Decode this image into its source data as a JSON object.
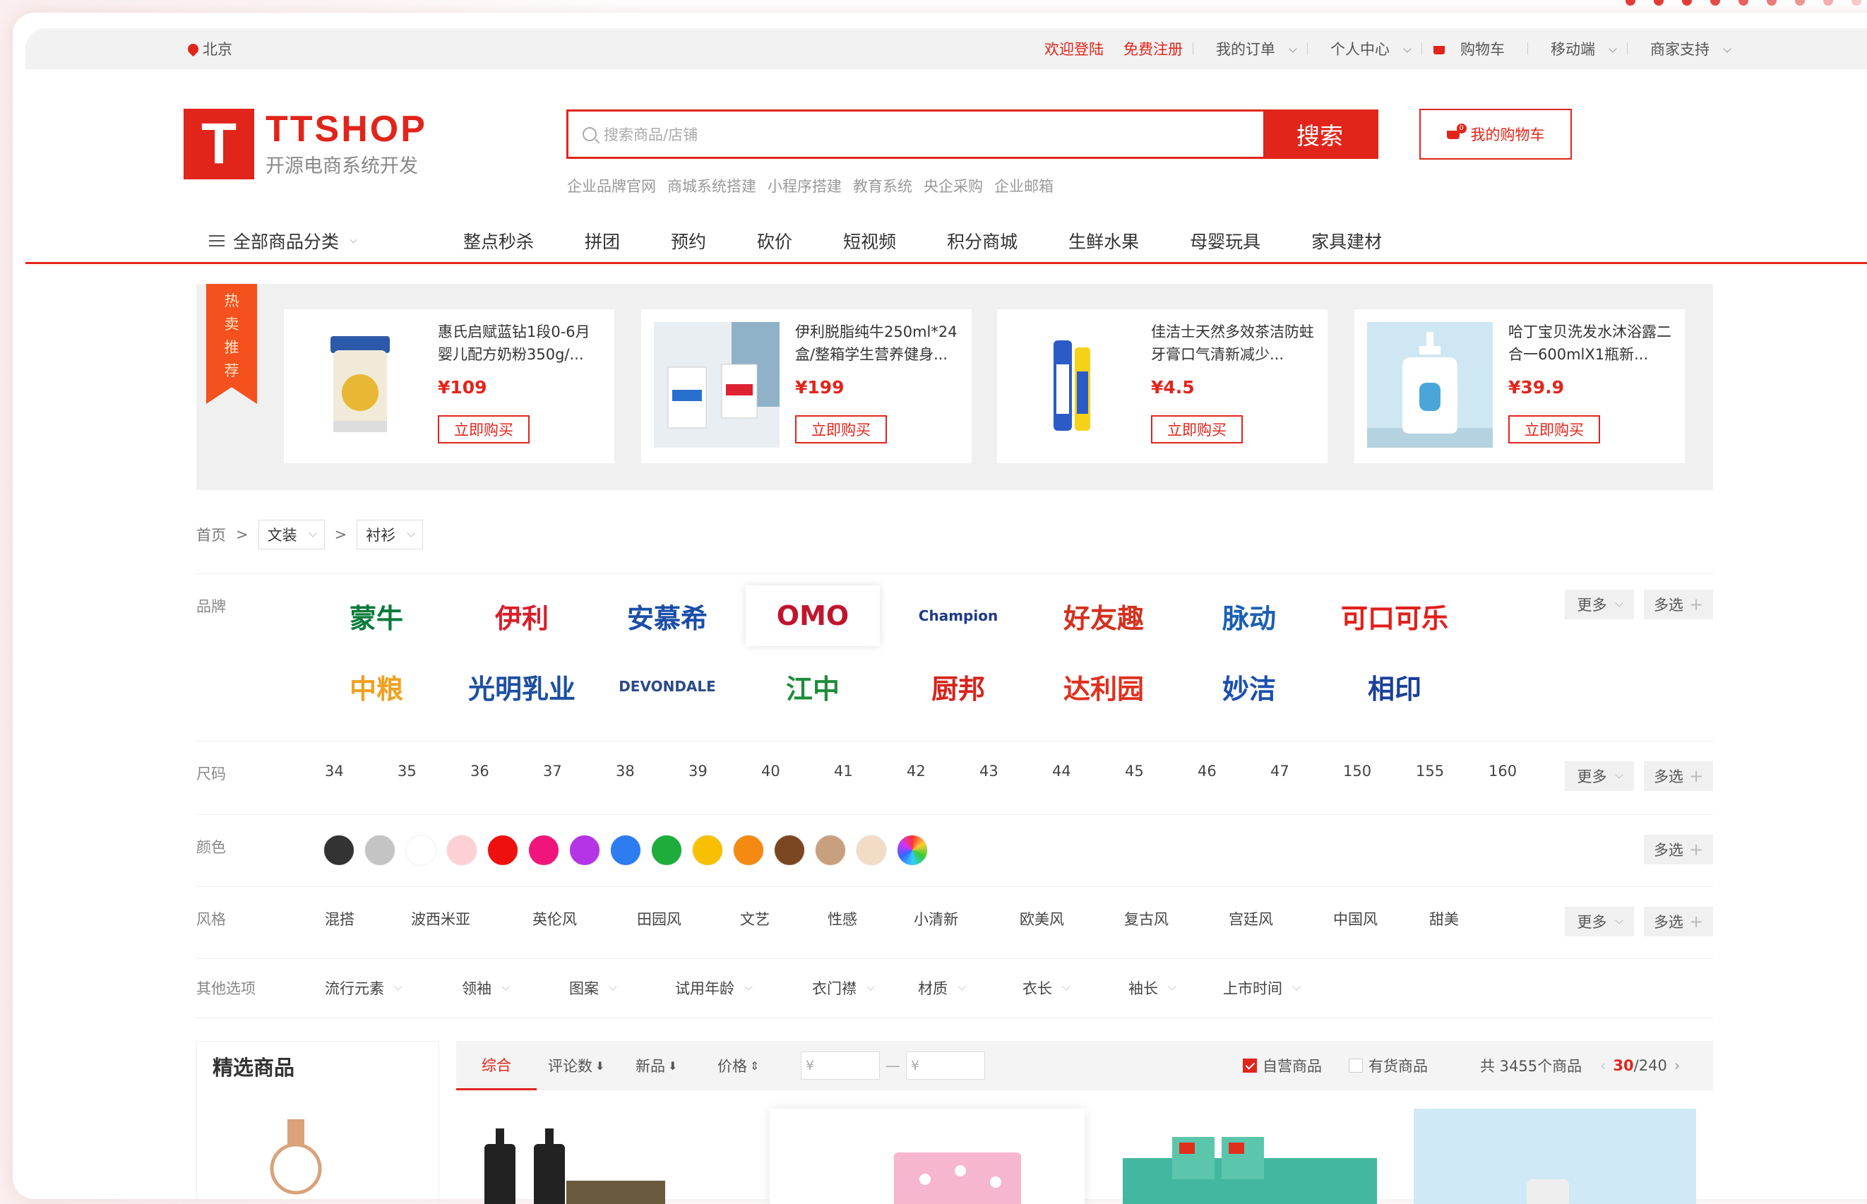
{
  "topbar": {
    "location": "北京",
    "login": "欢迎登陆",
    "register": "免费注册",
    "orders": "我的订单",
    "account": "个人中心",
    "cart": "购物车",
    "mobile": "移动端",
    "merchant": "商家支持"
  },
  "logo": {
    "mark": "T",
    "brand": "TTSHOP",
    "slogan": "开源电商系统开发"
  },
  "search": {
    "placeholder": "搜索商品/店铺",
    "button": "搜索",
    "hotwords": [
      "企业品牌官网",
      "商城系统搭建",
      "小程序搭建",
      "教育系统",
      "央企采购",
      "企业邮箱"
    ]
  },
  "mycart": {
    "label": "我的购物车",
    "count": "0"
  },
  "nav": {
    "allcat": "全部商品分类",
    "items": [
      "整点秒杀",
      "拼团",
      "预约",
      "砍价",
      "短视频",
      "积分商城",
      "生鲜水果",
      "母婴玩具",
      "家具建材"
    ]
  },
  "hot": {
    "ribbon": "热卖推荐",
    "cards": [
      {
        "name": "惠氏启赋蓝钻1段0-6月婴儿配方奶粉350g/...",
        "price": "¥109",
        "buy": "立即购买"
      },
      {
        "name": "伊利脱脂纯牛250ml*24盒/整箱学生营养健身...",
        "price": "¥199",
        "buy": "立即购买"
      },
      {
        "name": "佳洁士天然多效茶洁防蛀牙膏口气清新减少...",
        "price": "¥4.5",
        "buy": "立即购买"
      },
      {
        "name": "哈丁宝贝洗发水沐浴露二合一600mlX1瓶新...",
        "price": "¥39.9",
        "buy": "立即购买"
      }
    ]
  },
  "breadcrumb": {
    "home": "首页",
    "level1": "文装",
    "level2": "衬衫"
  },
  "filters": {
    "brand_label": "品牌",
    "brands": [
      {
        "name": "蒙牛",
        "color": "#0a7a3a"
      },
      {
        "name": "伊利",
        "color": "#d81e2a"
      },
      {
        "name": "安慕希",
        "color": "#1a4ea8"
      },
      {
        "name": "OMO",
        "color": "#c0142d"
      },
      {
        "name": "Champion",
        "color": "#1d3a8a"
      },
      {
        "name": "好友趣",
        "color": "#d4301f"
      },
      {
        "name": "脉动",
        "color": "#1a5fb4"
      },
      {
        "name": "可口可乐",
        "color": "#e0201b"
      },
      {
        "name": "中粮",
        "color": "#f0a020"
      },
      {
        "name": "光明乳业",
        "color": "#1c4fa0"
      },
      {
        "name": "DEVONDALE",
        "color": "#2a4a8a"
      },
      {
        "name": "江中",
        "color": "#1f8c3a"
      },
      {
        "name": "厨邦",
        "color": "#d4241c"
      },
      {
        "name": "达利园",
        "color": "#e0301c"
      },
      {
        "name": "妙洁",
        "color": "#1a4fb0"
      },
      {
        "name": "相印",
        "color": "#1a3f9a"
      }
    ],
    "size_label": "尺码",
    "sizes": [
      "34",
      "35",
      "36",
      "37",
      "38",
      "39",
      "40",
      "41",
      "42",
      "43",
      "44",
      "45",
      "46",
      "47",
      "150",
      "155",
      "160"
    ],
    "color_label": "颜色",
    "colors": [
      "#333333",
      "#c4c4c4",
      "#ffffff",
      "#fcd0d4",
      "#f00f0f",
      "#f0157a",
      "#b534e6",
      "#2d7cf0",
      "#1ead3a",
      "#f8c000",
      "#f48a12",
      "#7a4722",
      "#c9a07e",
      "#f3dcc6",
      "rainbow"
    ],
    "style_label": "风格",
    "styles": [
      "混搭",
      "波西米亚",
      "英伦风",
      "田园风",
      "文艺",
      "性感",
      "小清新",
      "欧美风",
      "复古风",
      "宫廷风",
      "中国风",
      "甜美"
    ],
    "other_label": "其他选项",
    "others": [
      "流行元素",
      "领袖",
      "图案",
      "试用年龄",
      "衣门襟",
      "材质",
      "衣长",
      "袖长",
      "上市时间"
    ],
    "more": "更多",
    "multi": "多选"
  },
  "selected": {
    "title": "精选商品"
  },
  "sortbar": {
    "tabs": [
      "综合",
      "评论数",
      "新品",
      "价格"
    ],
    "price_from": "¥",
    "price_to": "¥",
    "self_run": "自营商品",
    "in_stock": "有货商品",
    "total": "共 3455个商品",
    "page_current": "30",
    "page_total": "/240"
  },
  "colors": {
    "accent": "#e1251b"
  }
}
